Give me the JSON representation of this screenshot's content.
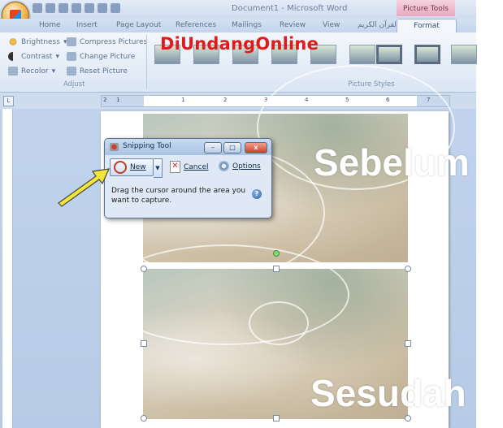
{
  "window": {
    "title": "Document1 - Microsoft Word",
    "contextual_tools": "Picture Tools"
  },
  "tabs": [
    "Home",
    "Insert",
    "Page Layout",
    "References",
    "Mailings",
    "Review",
    "View",
    "القرآن الكريم",
    "Format"
  ],
  "active_tab": "Format",
  "ribbon": {
    "adjust": {
      "brightness": "Brightness",
      "contrast": "Contrast",
      "recolor": "Recolor",
      "compress": "Compress Pictures",
      "change": "Change Picture",
      "reset": "Reset Picture",
      "label": "Adjust"
    },
    "picture_styles_label": "Picture Styles"
  },
  "brand_text": "DiUndangOnline",
  "ruler": {
    "corner": "L",
    "numbers": [
      "1",
      "2",
      "1",
      "1",
      "2",
      "3",
      "4",
      "5",
      "6",
      "7"
    ]
  },
  "document": {
    "before_label": "Sebelum",
    "after_label": "Sesudah"
  },
  "snipping_tool": {
    "title": "Snipping Tool",
    "new_label": "New",
    "cancel_label": "Cancel",
    "options_label": "Options",
    "message": "Drag the cursor around the area you want to capture.",
    "help": "?",
    "min": "–",
    "max": "□",
    "close": "x"
  },
  "colors": {
    "brand": "#e01b1b",
    "arrow": "#f2e63a",
    "ribbon_bg": "#dbe6f4"
  }
}
